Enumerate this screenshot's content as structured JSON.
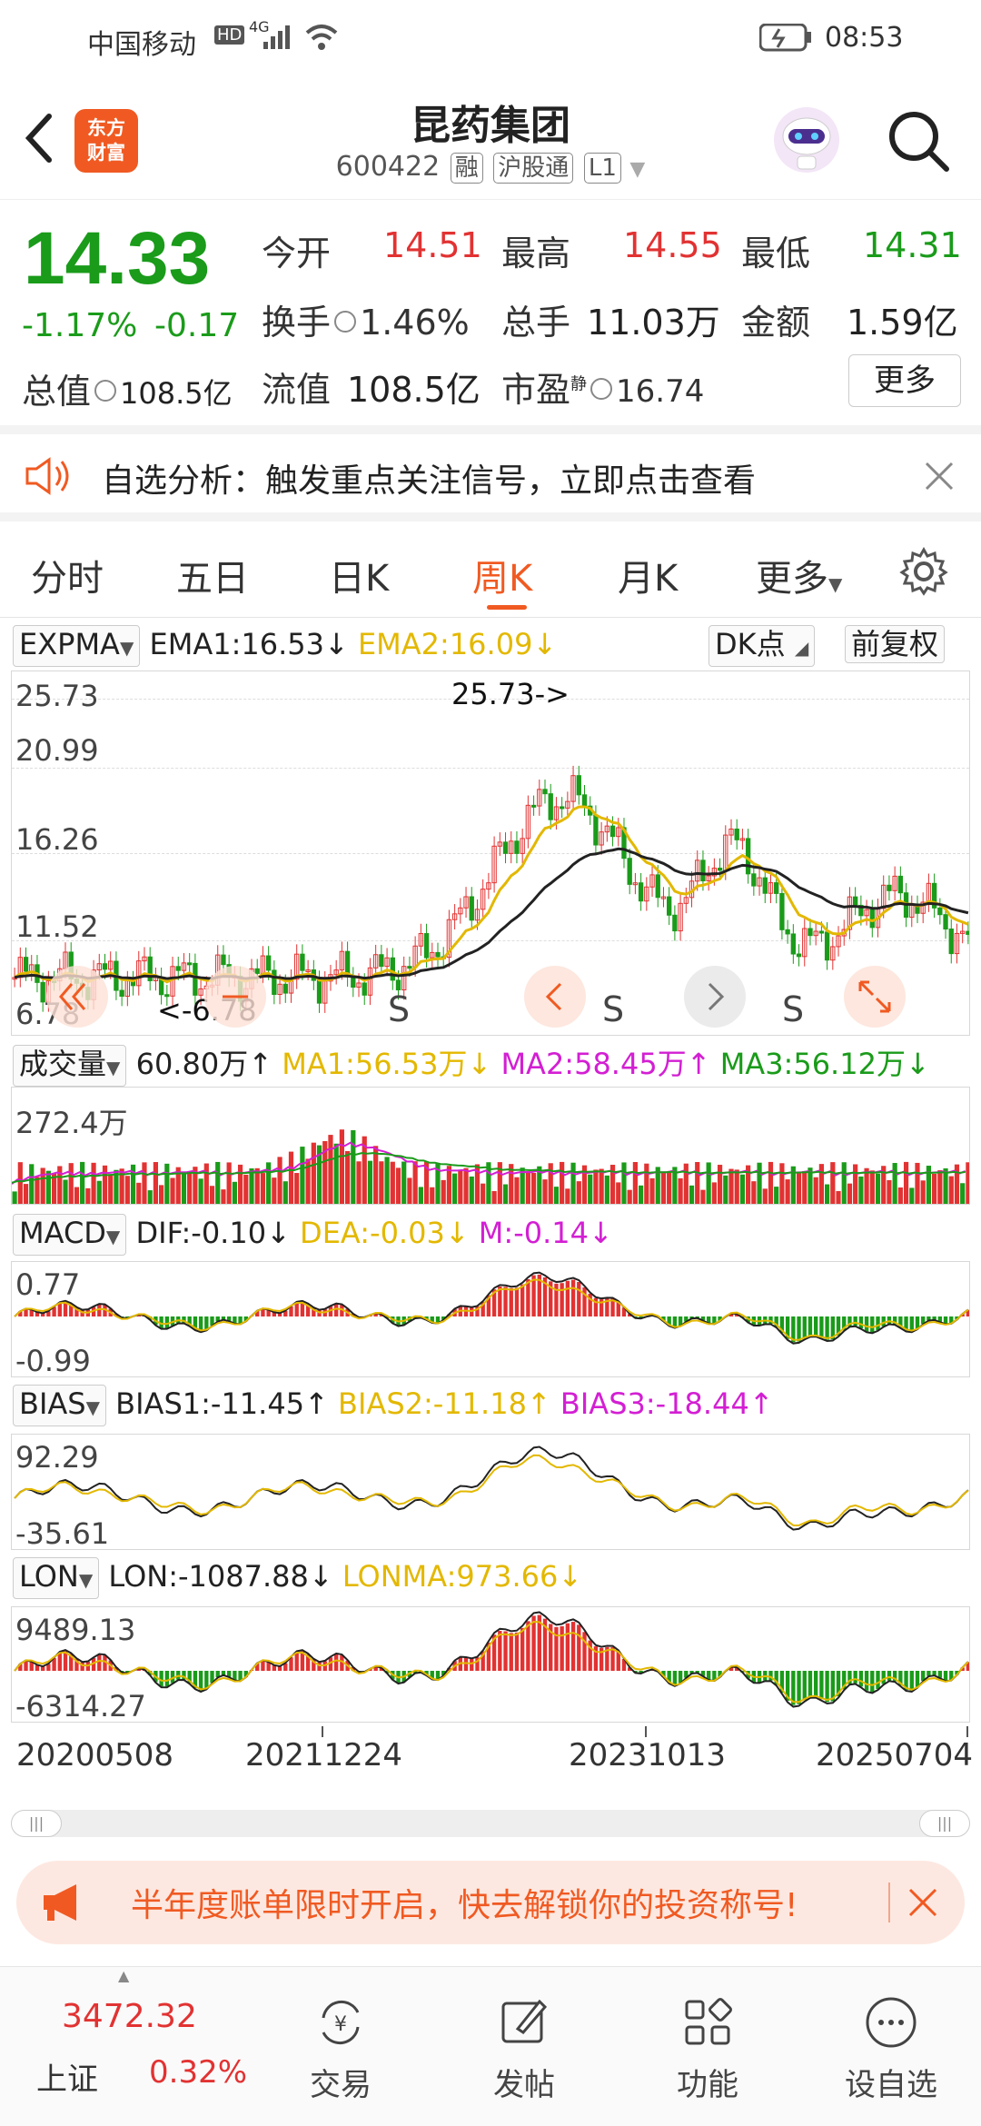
{
  "status": {
    "carrier": "中国移动",
    "net1": "HD",
    "net2": "4G",
    "time": "08:53"
  },
  "header": {
    "logo_line1": "东方",
    "logo_line2": "财富",
    "title": "昆药集团",
    "code": "600422",
    "tags": [
      "融",
      "沪股通",
      "L1"
    ]
  },
  "quote": {
    "price": "14.33",
    "change_pct": "-1.17%",
    "change": "-0.17",
    "open_label": "今开",
    "open": "14.51",
    "high_label": "最高",
    "high": "14.55",
    "low_label": "最低",
    "low": "14.31",
    "turnover_label": "换手",
    "turnover": "1.46%",
    "volume_label": "总手",
    "volume": "11.03万",
    "amount_label": "金额",
    "amount": "1.59亿",
    "mktcap_label": "总值",
    "mktcap": "108.5亿",
    "float_label": "流值",
    "float": "108.5亿",
    "pe_label": "市盈",
    "pe_sup": "静",
    "pe": "16.74",
    "more": "更多"
  },
  "notice": {
    "text": "自选分析：触发重点关注信号，立即点击查看"
  },
  "tabs": [
    "分时",
    "五日",
    "日K",
    "周K",
    "月K",
    "更多"
  ],
  "active_tab": "周K",
  "chart_data": [
    {
      "type": "line",
      "indicator": "EXPMA",
      "series": [
        {
          "name": "EMA1",
          "value": "EMA1:16.53↓",
          "color": "#222222"
        },
        {
          "name": "EMA2",
          "value": "EMA2:16.09↓",
          "color": "#e3b800"
        }
      ],
      "y_ticks": [
        "25.73",
        "20.99",
        "16.26",
        "11.52",
        "6.78"
      ],
      "annotations": [
        "25.73->",
        "<-6.78"
      ],
      "signals": [
        "S",
        "S",
        "S"
      ],
      "buttons": {
        "dk": "DK点",
        "adjust": "前复权"
      },
      "ylim": [
        6.78,
        25.73
      ]
    },
    {
      "type": "bar",
      "indicator": "成交量",
      "series": [
        {
          "name": "VOL",
          "value": "60.80万↑",
          "color": "#222222"
        },
        {
          "name": "MA1",
          "value": "MA1:56.53万↓",
          "color": "#e3b800"
        },
        {
          "name": "MA2",
          "value": "MA2:58.45万↑",
          "color": "#d31fd3"
        },
        {
          "name": "MA3",
          "value": "MA3:56.12万↓",
          "color": "#1a9b1a"
        }
      ],
      "y_ticks": [
        "272.4万"
      ]
    },
    {
      "type": "bar",
      "indicator": "MACD",
      "series": [
        {
          "name": "DIF",
          "value": "DIF:-0.10↓",
          "color": "#222222"
        },
        {
          "name": "DEA",
          "value": "DEA:-0.03↓",
          "color": "#e3b800"
        },
        {
          "name": "M",
          "value": "M:-0.14↓",
          "color": "#d31fd3"
        }
      ],
      "y_ticks": [
        "0.77",
        "-0.99"
      ]
    },
    {
      "type": "line",
      "indicator": "BIAS",
      "series": [
        {
          "name": "BIAS1",
          "value": "BIAS1:-11.45↑",
          "color": "#222222"
        },
        {
          "name": "BIAS2",
          "value": "BIAS2:-11.18↑",
          "color": "#e3b800"
        },
        {
          "name": "BIAS3",
          "value": "BIAS3:-18.44↑",
          "color": "#d31fd3"
        }
      ],
      "y_ticks": [
        "92.29",
        "-35.61"
      ]
    },
    {
      "type": "bar",
      "indicator": "LON",
      "series": [
        {
          "name": "LON",
          "value": "LON:-1087.88↓",
          "color": "#222222"
        },
        {
          "name": "LONMA",
          "value": "LONMA:973.66↓",
          "color": "#e3b800"
        }
      ],
      "y_ticks": [
        "9489.13",
        "-6314.27"
      ]
    }
  ],
  "dates": [
    "20200508",
    "20211224",
    "20231013",
    "20250704"
  ],
  "promo": {
    "text": "半年度账单限时开启，快去解锁你的投资称号!"
  },
  "bottom_nav": {
    "index_value": "3472.32",
    "index_name": "上证",
    "index_change": "0.32%",
    "items": [
      "交易",
      "发帖",
      "功能",
      "设自选"
    ]
  }
}
